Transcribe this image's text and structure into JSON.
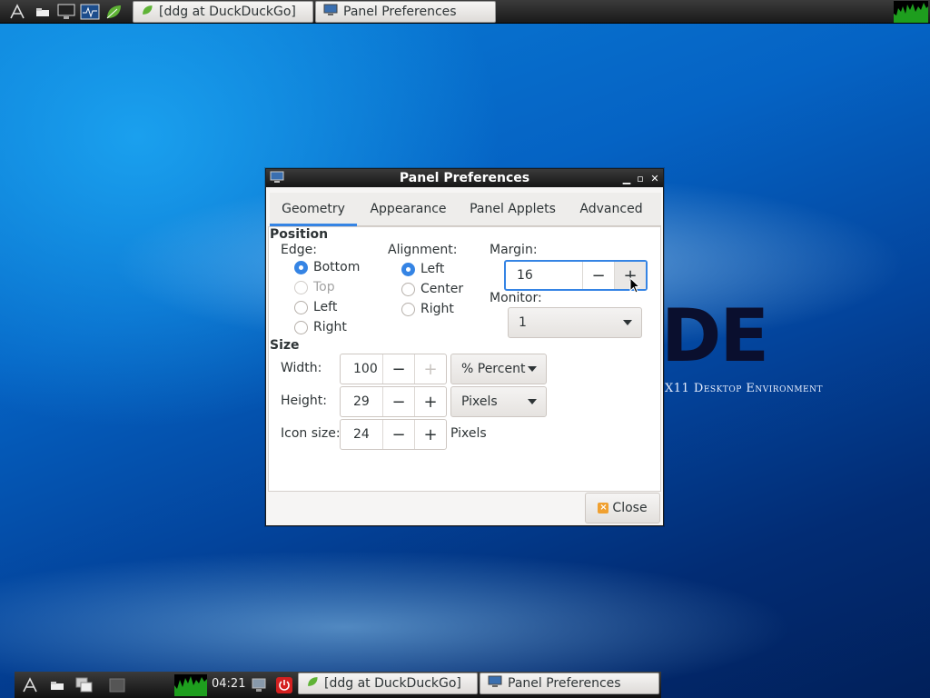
{
  "top_panel": {
    "tasks": [
      {
        "label": "[ddg at DuckDuckGo]",
        "icon": "leaf-icon"
      },
      {
        "label": "Panel Preferences",
        "icon": "monitor-icon"
      }
    ]
  },
  "bottom_panel": {
    "clock": "04:21",
    "tasks": [
      {
        "label": "[ddg at DuckDuckGo]",
        "icon": "leaf-icon"
      },
      {
        "label": "Panel Preferences",
        "icon": "monitor-icon"
      }
    ]
  },
  "dialog": {
    "title": "Panel Preferences",
    "tabs": [
      "Geometry",
      "Appearance",
      "Panel Applets",
      "Advanced"
    ],
    "active_tab": "Geometry",
    "position": {
      "title": "Position",
      "edge_label": "Edge:",
      "edge_options": [
        "Bottom",
        "Top",
        "Left",
        "Right"
      ],
      "edge_selected": "Bottom",
      "alignment_label": "Alignment:",
      "alignment_options": [
        "Left",
        "Center",
        "Right"
      ],
      "alignment_selected": "Left",
      "margin_label": "Margin:",
      "margin_value": "16",
      "monitor_label": "Monitor:",
      "monitor_value": "1"
    },
    "size": {
      "title": "Size",
      "width_label": "Width:",
      "width_value": "100",
      "width_unit": "% Percent",
      "height_label": "Height:",
      "height_value": "29",
      "height_unit": "Pixels",
      "icon_size_label": "Icon size:",
      "icon_size_value": "24",
      "icon_size_unit": "Pixels"
    },
    "close_label": "Close"
  },
  "wallpaper": {
    "logo_text": "DE",
    "logo_subtitle": "X11 Desktop Environment"
  },
  "colors": {
    "accent": "#3584e4",
    "panel": "#1f1f1f"
  }
}
